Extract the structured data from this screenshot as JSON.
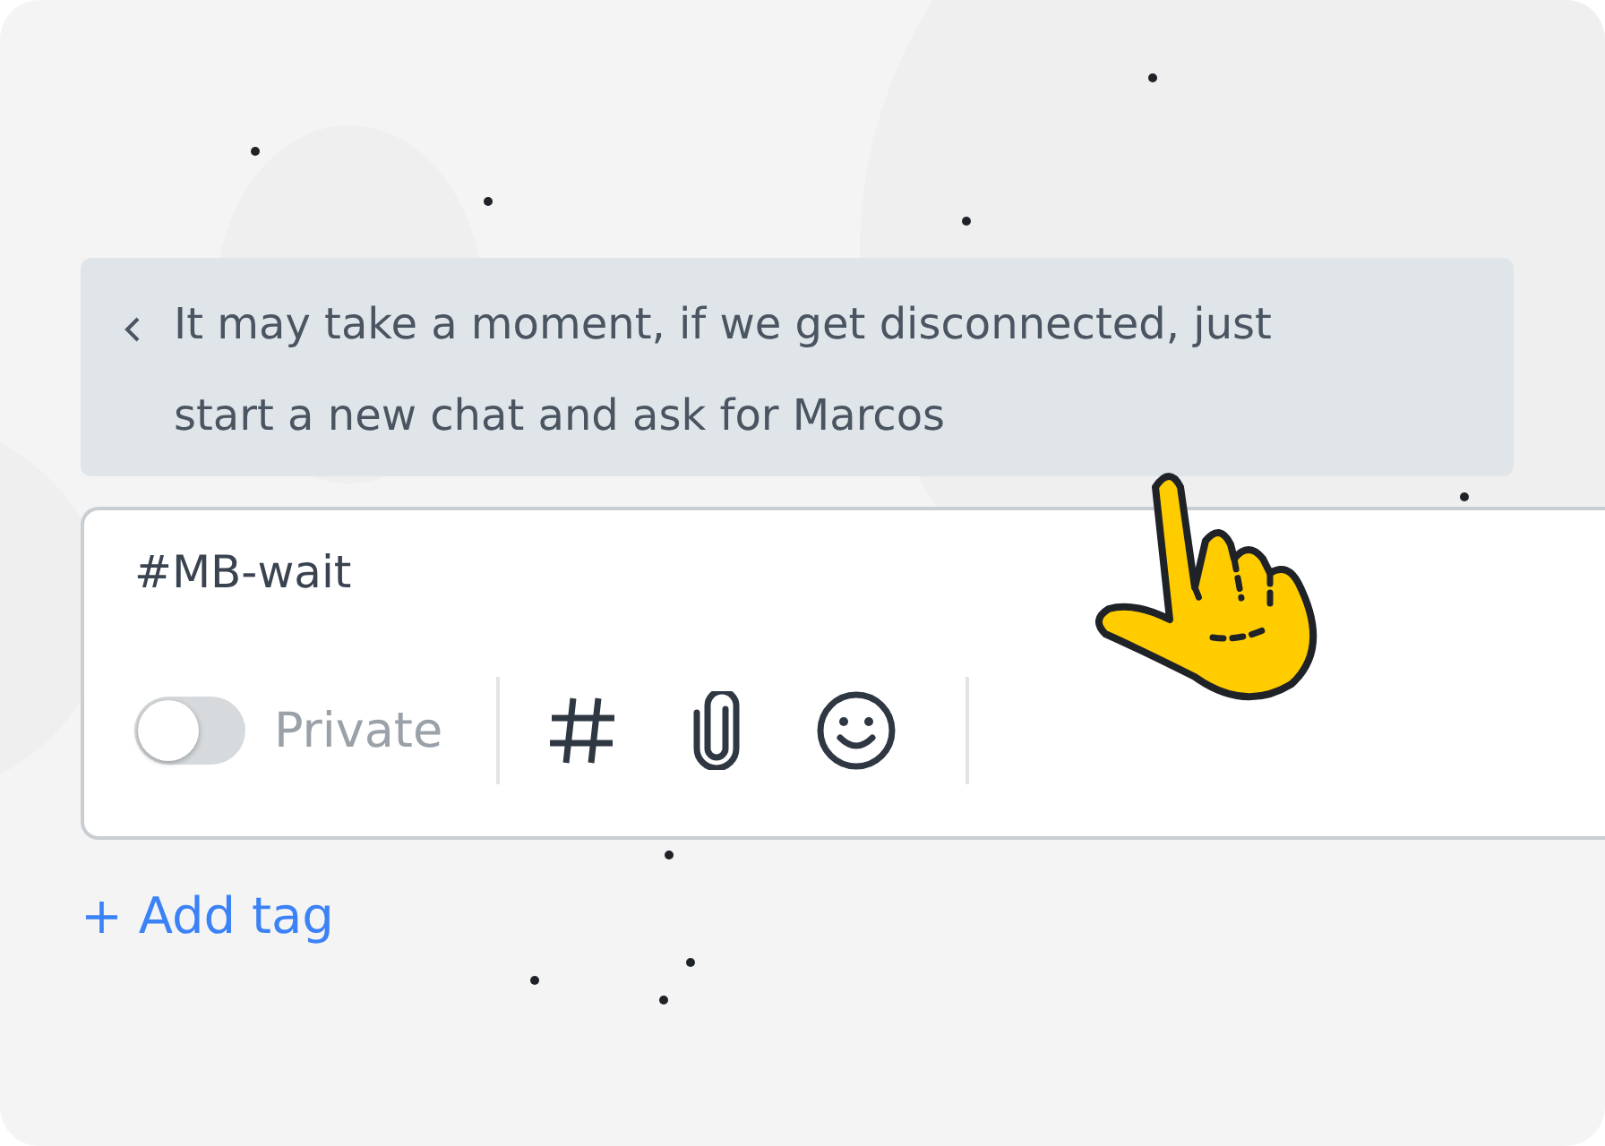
{
  "suggestion": {
    "text": "It may take a moment, if we get disconnected, just start a new chat and ask for Marcos"
  },
  "composer": {
    "value": "#MB-wait",
    "private": {
      "label": "Private",
      "on": false
    }
  },
  "add_tag": "+ Add tag"
}
